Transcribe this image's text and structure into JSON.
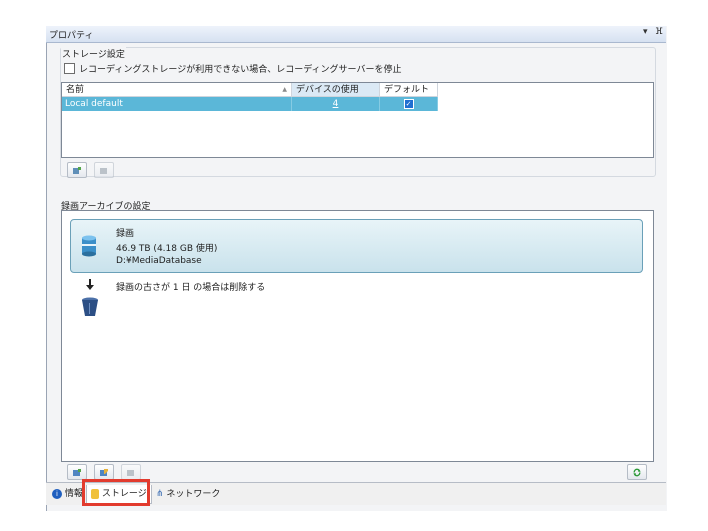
{
  "panel": {
    "title": "プロパティ",
    "dropdown_glyph": "▾",
    "pin_glyph": "ⴼ"
  },
  "storage_settings": {
    "group_label": "ストレージ設定",
    "stop_checkbox_label": "レコーディングストレージが利用できない場合、レコーディングサーバーを停止",
    "stop_checkbox_checked": false,
    "columns": [
      "名前",
      "デバイスの使用",
      "デフォルト"
    ],
    "sort_glyph": "▲",
    "rows": [
      {
        "name": "Local default",
        "device_usage": "4",
        "default_checked": true
      }
    ]
  },
  "archive_settings": {
    "group_label": "録画アーカイブの設定",
    "recording": {
      "title": "録画",
      "size": "46.9 TB (4.18 GB 使用)",
      "path": "D:¥MediaDatabase"
    },
    "delete_rule": "録画の古さが 1 日 の場合は削除する"
  },
  "tabs": [
    {
      "label": "情報",
      "icon": "info-icon"
    },
    {
      "label": "ストレージ",
      "icon": "storage-icon",
      "selected": true
    },
    {
      "label": "ネットワーク",
      "icon": "network-icon"
    }
  ],
  "colors": {
    "selected_row": "#5bb7d8",
    "highlight": "#e23b2e"
  }
}
